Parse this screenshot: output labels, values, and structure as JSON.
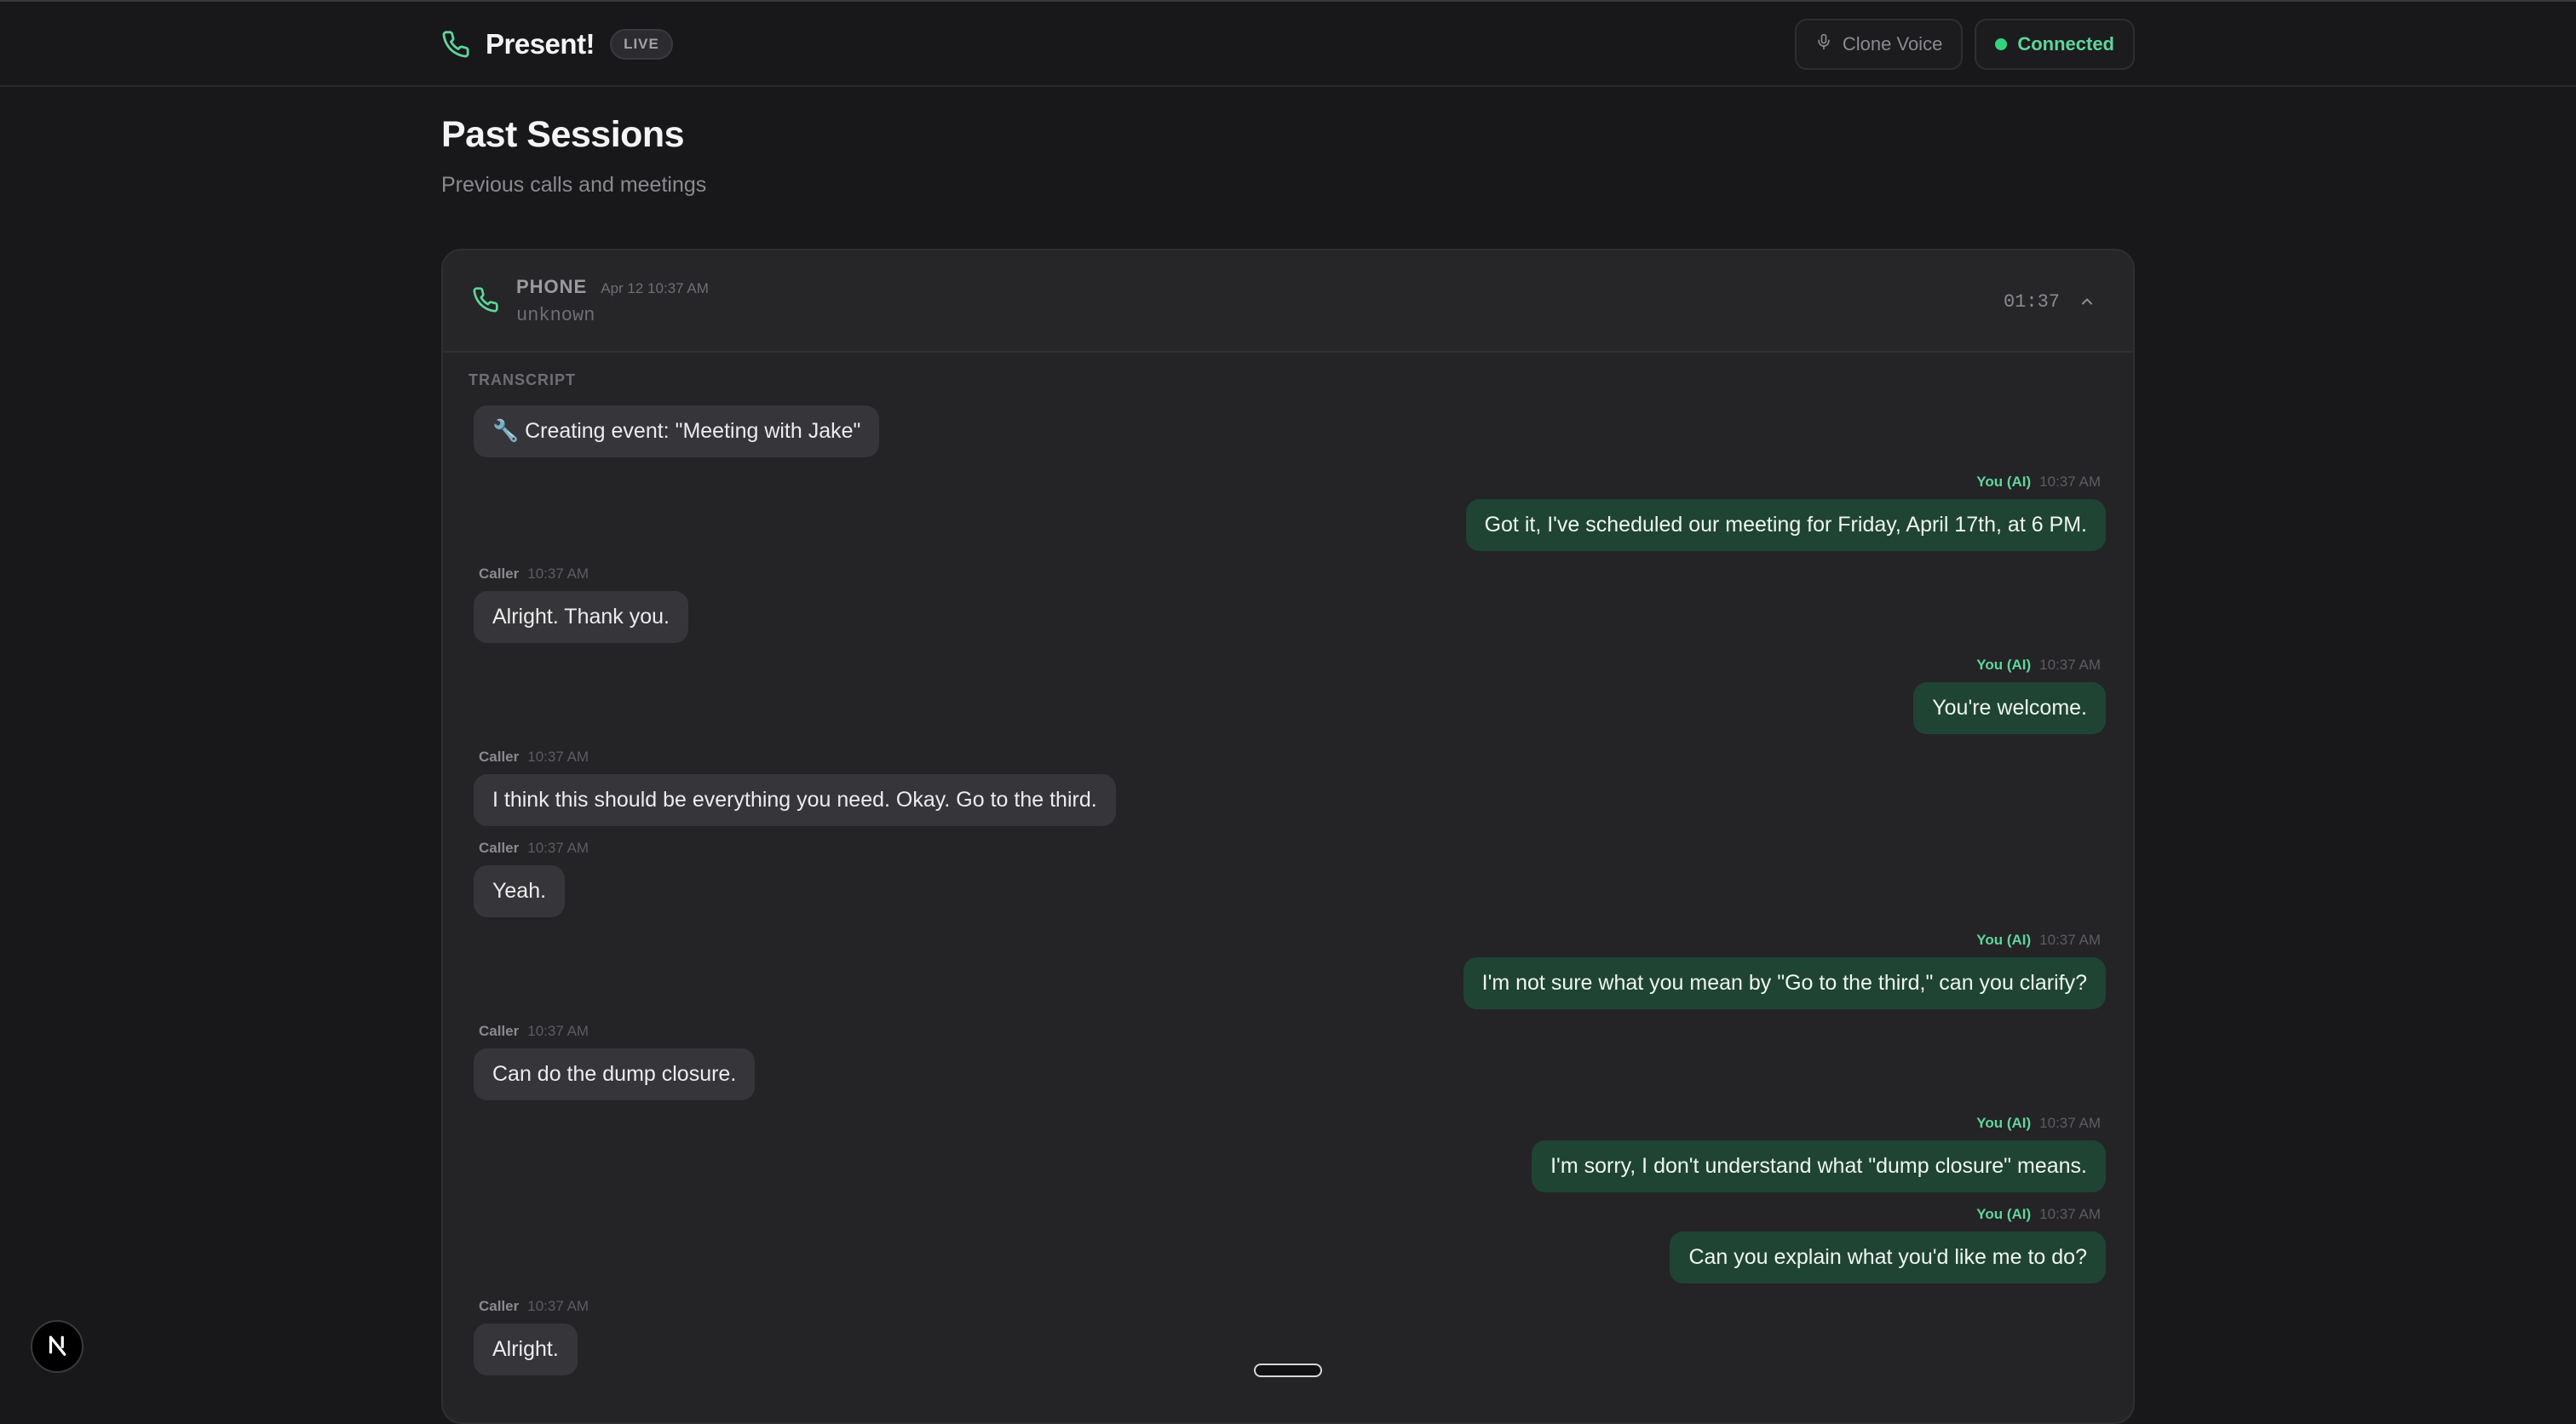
{
  "app": {
    "title": "Present!",
    "badge": "LIVE",
    "clone_voice_label": "Clone Voice",
    "status_label": "Connected",
    "status_color": "#34d27f",
    "accent_color": "#5ed69a"
  },
  "page": {
    "title": "Past Sessions",
    "subtitle": "Previous calls and meetings"
  },
  "session": {
    "type": "PHONE",
    "date": "Apr 12 10:37 AM",
    "caller": "unknown",
    "duration": "01:37",
    "icon": "phone-icon",
    "transcript_label": "TRANSCRIPT",
    "messages": [
      {
        "role": "tool",
        "text": "🔧 Creating event: \"Meeting with Jake\""
      },
      {
        "role": "ai",
        "speaker": "You (AI)",
        "time": "10:37 AM",
        "text": "Got it, I've scheduled our meeting for Friday, April 17th, at 6 PM."
      },
      {
        "role": "caller",
        "speaker": "Caller",
        "time": "10:37 AM",
        "text": "Alright. Thank you."
      },
      {
        "role": "ai",
        "speaker": "You (AI)",
        "time": "10:37 AM",
        "text": "You're welcome."
      },
      {
        "role": "caller",
        "speaker": "Caller",
        "time": "10:37 AM",
        "text": "I think this should be everything you need. Okay. Go to the third."
      },
      {
        "role": "caller",
        "speaker": "Caller",
        "time": "10:37 AM",
        "text": "Yeah."
      },
      {
        "role": "ai",
        "speaker": "You (AI)",
        "time": "10:37 AM",
        "text": "I'm not sure what you mean by \"Go to the third,\" can you clarify?"
      },
      {
        "role": "caller",
        "speaker": "Caller",
        "time": "10:37 AM",
        "text": "Can do the dump closure."
      },
      {
        "role": "ai",
        "speaker": "You (AI)",
        "time": "10:37 AM",
        "text": "I'm sorry, I don't understand what \"dump closure\" means."
      },
      {
        "role": "ai",
        "speaker": "You (AI)",
        "time": "10:37 AM",
        "text": "Can you explain what you'd like me to do?"
      },
      {
        "role": "caller",
        "speaker": "Caller",
        "time": "10:37 AM",
        "text": "Alright."
      }
    ]
  },
  "dev_badge": "N"
}
